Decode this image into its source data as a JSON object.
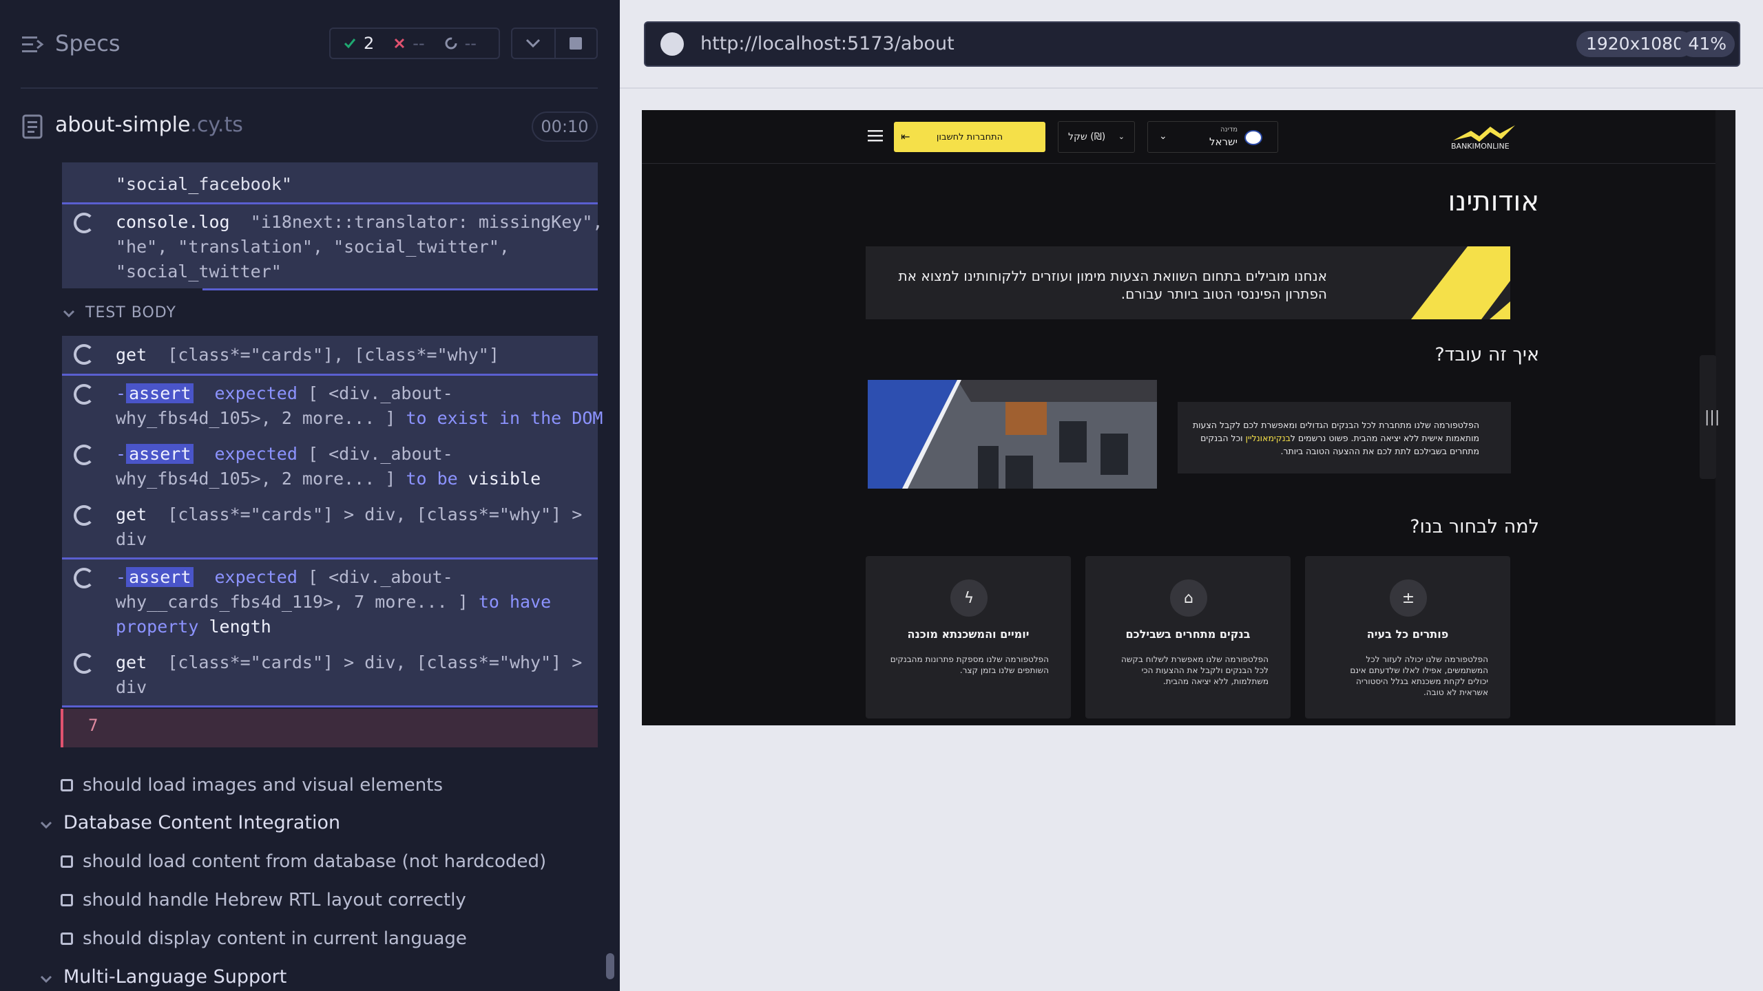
{
  "reporter": {
    "title": "Specs",
    "stats": {
      "passed": "2",
      "failed": "--",
      "pending": "--"
    },
    "spec": {
      "name": "about-simple",
      "ext": ".cy.ts",
      "duration": "00:10"
    },
    "commands": [
      {
        "lines": "\"social_facebook\""
      },
      {
        "name": "console.log",
        "message": "\"i18next::translator: missingKey\",\n\"he\", \"translation\", \"social_twitter\",\n\"social_twitter\""
      },
      {
        "name": "get",
        "message": "[class*=\"cards\"], [class*=\"why\"]"
      },
      {
        "name": "assert",
        "prefix": "-",
        "p1": "expected",
        "p2": "[ <div._about-\nwhy_fbs4d_105>, 2 more... ]",
        "p3": "to exist in the DOM"
      },
      {
        "name": "assert",
        "prefix": "-",
        "p1": "expected",
        "p2": "[ <div._about-\nwhy_fbs4d_105>, 2 more... ]",
        "p3": "to be",
        "p4": "visible"
      },
      {
        "name": "get",
        "message": "[class*=\"cards\"] > div, [class*=\"why\"] >\ndiv"
      },
      {
        "name": "assert",
        "prefix": "-",
        "p1": "expected",
        "p2": "[ <div._about-\nwhy__cards_fbs4d_119>, 7 more... ]",
        "p3": "to have\nproperty",
        "p4": "length"
      },
      {
        "name": "get",
        "message": "[class*=\"cards\"] > div, [class*=\"why\"] >\ndiv"
      }
    ],
    "test_body_label": "TEST BODY",
    "error_value": "7",
    "items": [
      {
        "type": "test",
        "label": "should load images and visual elements"
      },
      {
        "type": "suite",
        "label": "Database Content Integration"
      },
      {
        "type": "test",
        "label": "should load content from database (not hardcoded)"
      },
      {
        "type": "test",
        "label": "should handle Hebrew RTL layout correctly"
      },
      {
        "type": "test",
        "label": "should display content in current language"
      },
      {
        "type": "suite",
        "label": "Multi-Language Support"
      }
    ]
  },
  "aut": {
    "url": "http://localhost:5173/about",
    "viewport": "1920x1080",
    "zoom": "41%"
  },
  "site": {
    "brand": "BANKIMONLINE",
    "login_label": "התחברות לחשבון",
    "currency": "שקל (₪)",
    "country_small": "מדינה",
    "country": "ישראל",
    "title": "אודותינו",
    "hero": "אנחנו מובילים בתחום השוואת הצעות מימון ועוזרים ללקוחותינו למצוא את הפתרון הפיננסי הטוב ביותר עבורם.",
    "how_title": "איך זה עובד?",
    "how_text_1": "הפלטפורמה שלנו מתחברת לכל הבנקים הגדולים ומאפשרת לכם לקבל הצעות מותאמות אישית ללא יציאה מהבית. פשוט נרשמים ל",
    "how_text_hl": "בנקימאונליין",
    "how_text_2": " וכל הבנקים מתחרים בשבילכם לתת לכם את ההצעה הטובה ביותר.",
    "why_title": "למה לבחור בנו?",
    "cards": [
      {
        "icon": "lightning-icon",
        "title": "יומיים והמשכנתא מוכנה",
        "desc": "הפלטפורמה שלנו מספקת פתרונות מהבנקים השותפים שלנו בזמן קצר."
      },
      {
        "icon": "bank-icon",
        "title": "בנקים מתחרים בשבילכם",
        "desc": "הפלטפורמה שלנו מאפשרת לשלוח בקשה לכל הבנקים ולקבל את ההצעות הכי משתלמות, ללא יציאה מהבית."
      },
      {
        "icon": "calculator-icon",
        "title": "פותרים כל בעיה",
        "desc": "הפלטפורמה שלנו יכולה לעזור לכל המשתמשים, אפילו לאלו שלדעתם אינם יכולים לקחת משכנתא בגלל היסטוריה אשראית לא טובה."
      }
    ]
  }
}
